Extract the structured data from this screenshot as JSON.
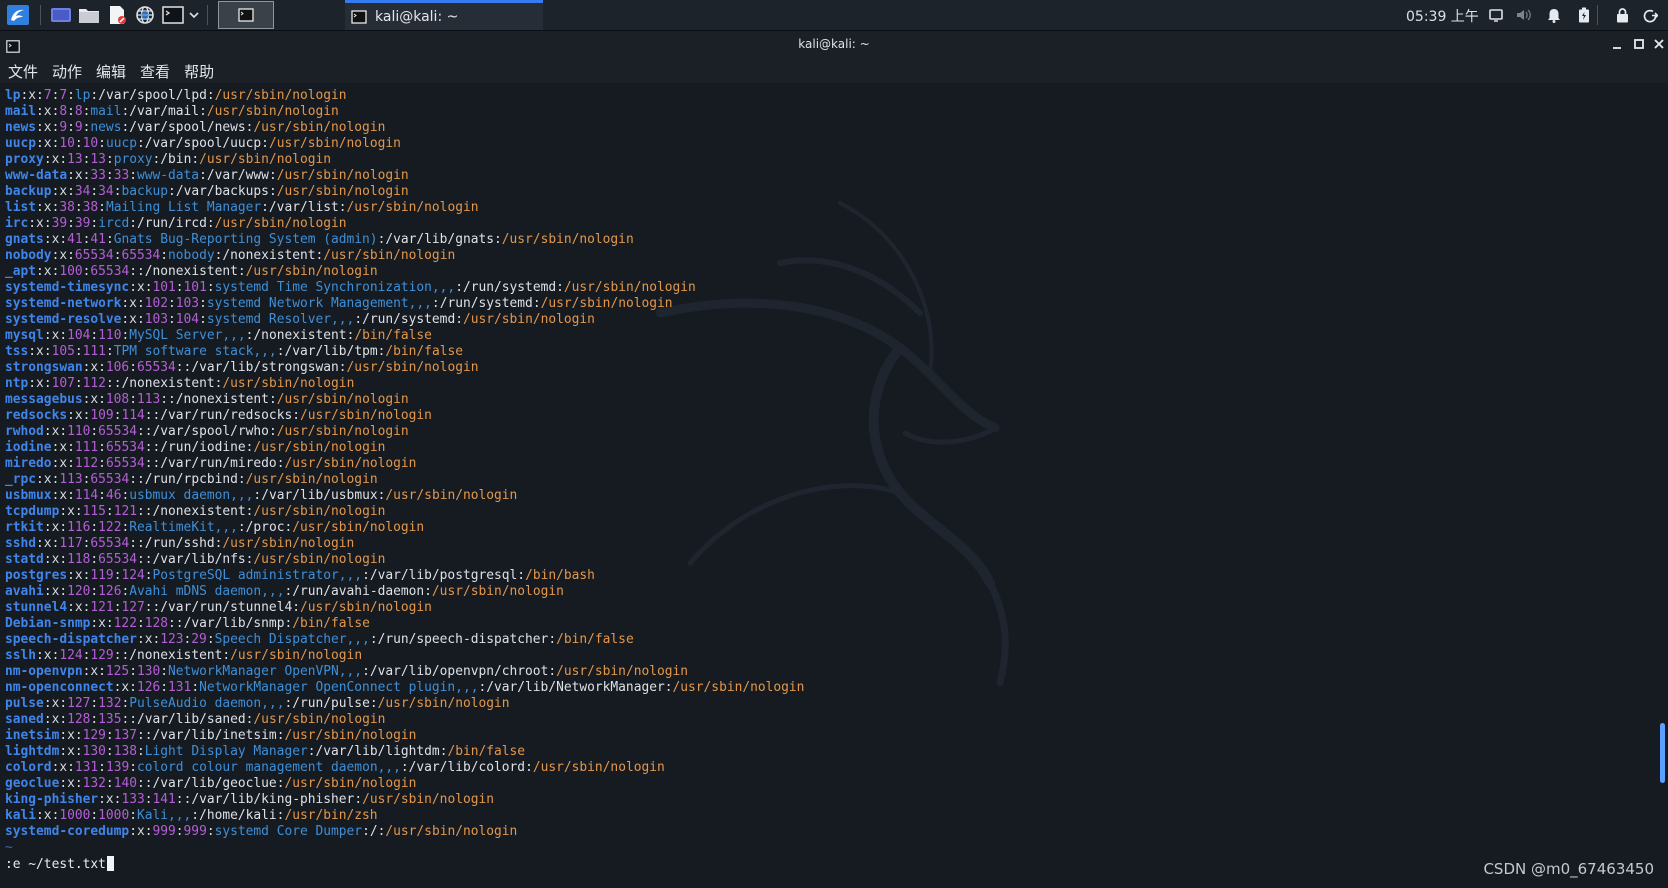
{
  "taskbar": {
    "window_title": "kali@kali: ~",
    "clock": "05:39 上午",
    "icons": [
      "kali-menu-icon",
      "workspace-icon",
      "file-manager-icon",
      "text-editor-icon",
      "browser-icon",
      "terminal-icon",
      "notifications-icon",
      "volume-icon",
      "battery-icon",
      "lock-icon",
      "logout-icon"
    ]
  },
  "window": {
    "title": "kali@kali: ~",
    "menu": [
      "文件",
      "动作",
      "编辑",
      "查看",
      "帮助"
    ]
  },
  "terminal": {
    "lines": [
      [
        "lp",
        "7",
        "7",
        "lp",
        "/var/spool/lpd",
        "/usr/sbin/nologin"
      ],
      [
        "mail",
        "8",
        "8",
        "mail",
        "/var/mail",
        "/usr/sbin/nologin"
      ],
      [
        "news",
        "9",
        "9",
        "news",
        "/var/spool/news",
        "/usr/sbin/nologin"
      ],
      [
        "uucp",
        "10",
        "10",
        "uucp",
        "/var/spool/uucp",
        "/usr/sbin/nologin"
      ],
      [
        "proxy",
        "13",
        "13",
        "proxy",
        "/bin",
        "/usr/sbin/nologin"
      ],
      [
        "www-data",
        "33",
        "33",
        "www-data",
        "/var/www",
        "/usr/sbin/nologin"
      ],
      [
        "backup",
        "34",
        "34",
        "backup",
        "/var/backups",
        "/usr/sbin/nologin"
      ],
      [
        "list",
        "38",
        "38",
        "Mailing List Manager",
        "/var/list",
        "/usr/sbin/nologin"
      ],
      [
        "irc",
        "39",
        "39",
        "ircd",
        "/run/ircd",
        "/usr/sbin/nologin"
      ],
      [
        "gnats",
        "41",
        "41",
        "Gnats Bug-Reporting System (admin)",
        "/var/lib/gnats",
        "/usr/sbin/nologin"
      ],
      [
        "nobody",
        "65534",
        "65534",
        "nobody",
        "/nonexistent",
        "/usr/sbin/nologin"
      ],
      [
        "_apt",
        "100",
        "65534",
        "",
        "/nonexistent",
        "/usr/sbin/nologin"
      ],
      [
        "systemd-timesync",
        "101",
        "101",
        "systemd Time Synchronization,,,",
        "/run/systemd",
        "/usr/sbin/nologin"
      ],
      [
        "systemd-network",
        "102",
        "103",
        "systemd Network Management,,,",
        "/run/systemd",
        "/usr/sbin/nologin"
      ],
      [
        "systemd-resolve",
        "103",
        "104",
        "systemd Resolver,,,",
        "/run/systemd",
        "/usr/sbin/nologin"
      ],
      [
        "mysql",
        "104",
        "110",
        "MySQL Server,,,",
        "/nonexistent",
        "/bin/false"
      ],
      [
        "tss",
        "105",
        "111",
        "TPM software stack,,,",
        "/var/lib/tpm",
        "/bin/false"
      ],
      [
        "strongswan",
        "106",
        "65534",
        "",
        "/var/lib/strongswan",
        "/usr/sbin/nologin"
      ],
      [
        "ntp",
        "107",
        "112",
        "",
        "/nonexistent",
        "/usr/sbin/nologin"
      ],
      [
        "messagebus",
        "108",
        "113",
        "",
        "/nonexistent",
        "/usr/sbin/nologin"
      ],
      [
        "redsocks",
        "109",
        "114",
        "",
        "/var/run/redsocks",
        "/usr/sbin/nologin"
      ],
      [
        "rwhod",
        "110",
        "65534",
        "",
        "/var/spool/rwho",
        "/usr/sbin/nologin"
      ],
      [
        "iodine",
        "111",
        "65534",
        "",
        "/run/iodine",
        "/usr/sbin/nologin"
      ],
      [
        "miredo",
        "112",
        "65534",
        "",
        "/var/run/miredo",
        "/usr/sbin/nologin"
      ],
      [
        "_rpc",
        "113",
        "65534",
        "",
        "/run/rpcbind",
        "/usr/sbin/nologin"
      ],
      [
        "usbmux",
        "114",
        "46",
        "usbmux daemon,,,",
        "/var/lib/usbmux",
        "/usr/sbin/nologin"
      ],
      [
        "tcpdump",
        "115",
        "121",
        "",
        "/nonexistent",
        "/usr/sbin/nologin"
      ],
      [
        "rtkit",
        "116",
        "122",
        "RealtimeKit,,,",
        "/proc",
        "/usr/sbin/nologin"
      ],
      [
        "sshd",
        "117",
        "65534",
        "",
        "/run/sshd",
        "/usr/sbin/nologin"
      ],
      [
        "statd",
        "118",
        "65534",
        "",
        "/var/lib/nfs",
        "/usr/sbin/nologin"
      ],
      [
        "postgres",
        "119",
        "124",
        "PostgreSQL administrator,,,",
        "/var/lib/postgresql",
        "/bin/bash"
      ],
      [
        "avahi",
        "120",
        "126",
        "Avahi mDNS daemon,,,",
        "/run/avahi-daemon",
        "/usr/sbin/nologin"
      ],
      [
        "stunnel4",
        "121",
        "127",
        "",
        "/var/run/stunnel4",
        "/usr/sbin/nologin"
      ],
      [
        "Debian-snmp",
        "122",
        "128",
        "",
        "/var/lib/snmp",
        "/bin/false"
      ],
      [
        "speech-dispatcher",
        "123",
        "29",
        "Speech Dispatcher,,,",
        "/run/speech-dispatcher",
        "/bin/false"
      ],
      [
        "sslh",
        "124",
        "129",
        "",
        "/nonexistent",
        "/usr/sbin/nologin"
      ],
      [
        "nm-openvpn",
        "125",
        "130",
        "NetworkManager OpenVPN,,,",
        "/var/lib/openvpn/chroot",
        "/usr/sbin/nologin"
      ],
      [
        "nm-openconnect",
        "126",
        "131",
        "NetworkManager OpenConnect plugin,,,",
        "/var/lib/NetworkManager",
        "/usr/sbin/nologin"
      ],
      [
        "pulse",
        "127",
        "132",
        "PulseAudio daemon,,,",
        "/run/pulse",
        "/usr/sbin/nologin"
      ],
      [
        "saned",
        "128",
        "135",
        "",
        "/var/lib/saned",
        "/usr/sbin/nologin"
      ],
      [
        "inetsim",
        "129",
        "137",
        "",
        "/var/lib/inetsim",
        "/usr/sbin/nologin"
      ],
      [
        "lightdm",
        "130",
        "138",
        "Light Display Manager",
        "/var/lib/lightdm",
        "/bin/false"
      ],
      [
        "colord",
        "131",
        "139",
        "colord colour management daemon,,,",
        "/var/lib/colord",
        "/usr/sbin/nologin"
      ],
      [
        "geoclue",
        "132",
        "140",
        "",
        "/var/lib/geoclue",
        "/usr/sbin/nologin"
      ],
      [
        "king-phisher",
        "133",
        "141",
        "",
        "/var/lib/king-phisher",
        "/usr/sbin/nologin"
      ],
      [
        "kali",
        "1000",
        "1000",
        "Kali,,,",
        "/home/kali",
        "/usr/bin/zsh"
      ],
      [
        "systemd-coredump",
        "999",
        "999",
        "systemd Core Dumper",
        "/",
        "/usr/sbin/nologin"
      ]
    ],
    "tilde": "~",
    "command": ":e ~/test.txt"
  },
  "watermark": "CSDN @m0_67463450",
  "colors": {
    "user": "#3f85ea",
    "id": "#b45fd5",
    "gecos": "#3e8fd8",
    "shell": "#e3974b",
    "accent": "#367bf0"
  }
}
